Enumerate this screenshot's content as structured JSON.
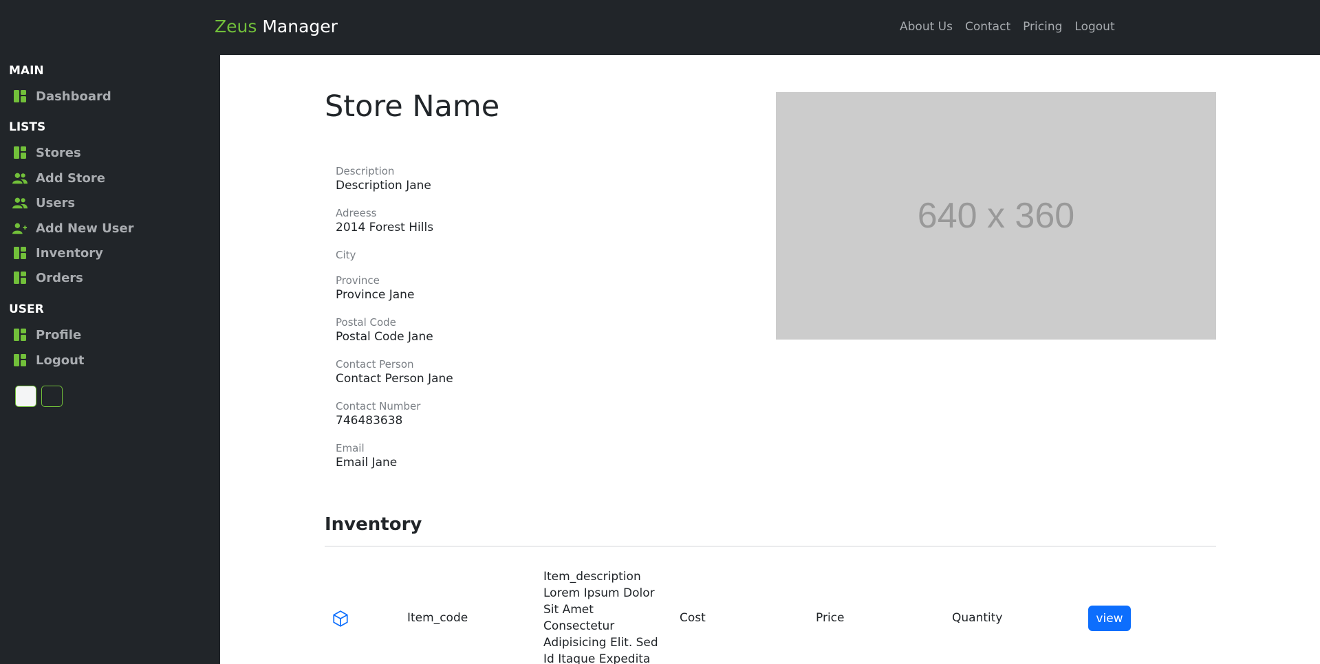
{
  "header": {
    "brand_accent": "Zeus",
    "brand_rest": "Manager",
    "nav": [
      "About Us",
      "Contact",
      "Pricing",
      "Logout"
    ]
  },
  "sidebar": {
    "sections": [
      {
        "title": "MAIN",
        "items": [
          {
            "label": "Dashboard",
            "icon": "dashboard-icon"
          }
        ]
      },
      {
        "title": "LISTS",
        "items": [
          {
            "label": "Stores",
            "icon": "dashboard-icon"
          },
          {
            "label": "Add Store",
            "icon": "users-icon"
          },
          {
            "label": "Users",
            "icon": "users-icon"
          },
          {
            "label": "Add New User",
            "icon": "user-plus-icon"
          },
          {
            "label": "Inventory",
            "icon": "dashboard-icon"
          },
          {
            "label": "Orders",
            "icon": "dashboard-icon"
          }
        ]
      },
      {
        "title": "USER",
        "items": [
          {
            "label": "Profile",
            "icon": "dashboard-icon"
          },
          {
            "label": "Logout",
            "icon": "dashboard-icon"
          }
        ]
      }
    ],
    "theme_toggles": [
      "light",
      "dark"
    ]
  },
  "store": {
    "title": "Store Name",
    "fields": [
      {
        "label": "Description",
        "value": "Description Jane"
      },
      {
        "label": "Adreess",
        "value": "2014 Forest Hills"
      },
      {
        "label": "City",
        "value": ""
      },
      {
        "label": "Province",
        "value": "Province Jane"
      },
      {
        "label": "Postal Code",
        "value": "Postal Code Jane"
      },
      {
        "label": "Contact Person",
        "value": "Contact Person Jane"
      },
      {
        "label": "Contact Number",
        "value": "746483638"
      },
      {
        "label": "Email",
        "value": "Email Jane"
      }
    ],
    "image_placeholder": "640 x 360"
  },
  "inventory": {
    "title": "Inventory",
    "rows": [
      {
        "icon": "box-icon",
        "item_code": "Item_code",
        "description": "Item_description Lorem Ipsum Dolor Sit Amet Consectetur Adipisicing Elit. Sed Id Itaque Expedita Facere Ipsa Qui.",
        "cost": "Cost",
        "price": "Price",
        "quantity": "Quantity",
        "action": "view"
      }
    ]
  },
  "colors": {
    "accent_green": "#72c03a",
    "sidebar_bg": "#212529",
    "primary_blue": "#0d6efd",
    "placeholder_bg": "#cccccc"
  }
}
